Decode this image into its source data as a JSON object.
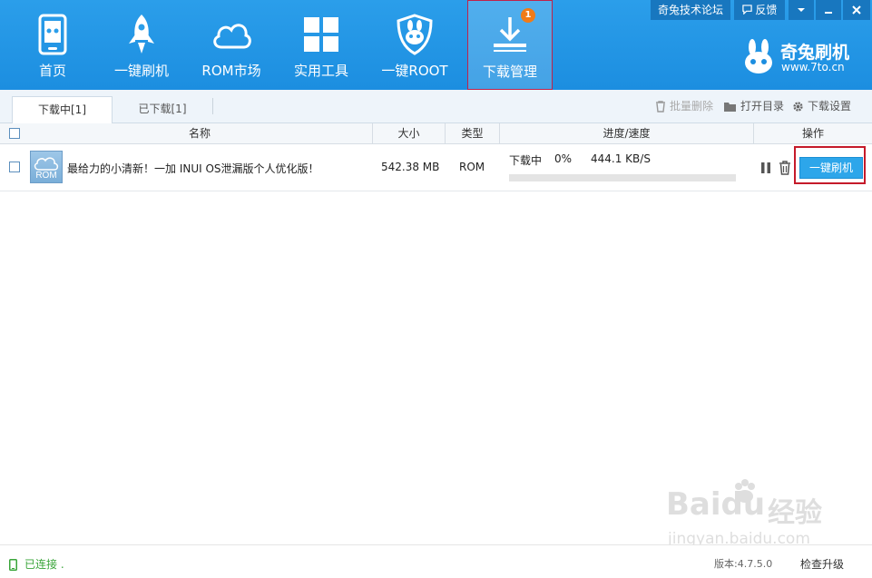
{
  "nav": {
    "items": [
      {
        "label": "首页",
        "icon": "phone-icon"
      },
      {
        "label": "一键刷机",
        "icon": "rocket-icon"
      },
      {
        "label": "ROM市场",
        "icon": "cloud-icon"
      },
      {
        "label": "实用工具",
        "icon": "grid-icon"
      },
      {
        "label": "一键ROOT",
        "icon": "shield-icon"
      },
      {
        "label": "下载管理",
        "icon": "download-icon",
        "active": true,
        "badge": "1"
      }
    ]
  },
  "top_links": {
    "forum": "奇兔技术论坛",
    "feedback": "反馈"
  },
  "brand": {
    "name": "奇兔刷机",
    "url": "www.7to.cn"
  },
  "tabs": [
    {
      "label": "下载中[1]",
      "active": true
    },
    {
      "label": "已下载[1]",
      "active": false
    }
  ],
  "toolbar": {
    "batch_delete": "批量删除",
    "open_dir": "打开目录",
    "download_settings": "下载设置"
  },
  "table": {
    "headers": {
      "name": "名称",
      "size": "大小",
      "type": "类型",
      "progress": "进度/速度",
      "action": "操作"
    },
    "rows": [
      {
        "thumb": "ROM",
        "name": "最给力的小清新！一加 INUI OS泄漏版个人优化版！",
        "size": "542.38 MB",
        "type": "ROM",
        "status": "下载中",
        "percent": "0%",
        "progress": 0,
        "speed": "444.1 KB/S",
        "flash_label": "一键刷机"
      }
    ]
  },
  "footer": {
    "status": "已连接 .",
    "version": "版本:4.7.5.0",
    "upgrade": "检查升级"
  },
  "watermark": {
    "brand": "Baidu",
    "brand_cn": "经验",
    "url": "jingyan.baidu.com"
  },
  "colors": {
    "header": "#1c8ee0",
    "accent": "#2da6ea",
    "highlight": "#c51a2a",
    "connected": "#3aa53a"
  }
}
